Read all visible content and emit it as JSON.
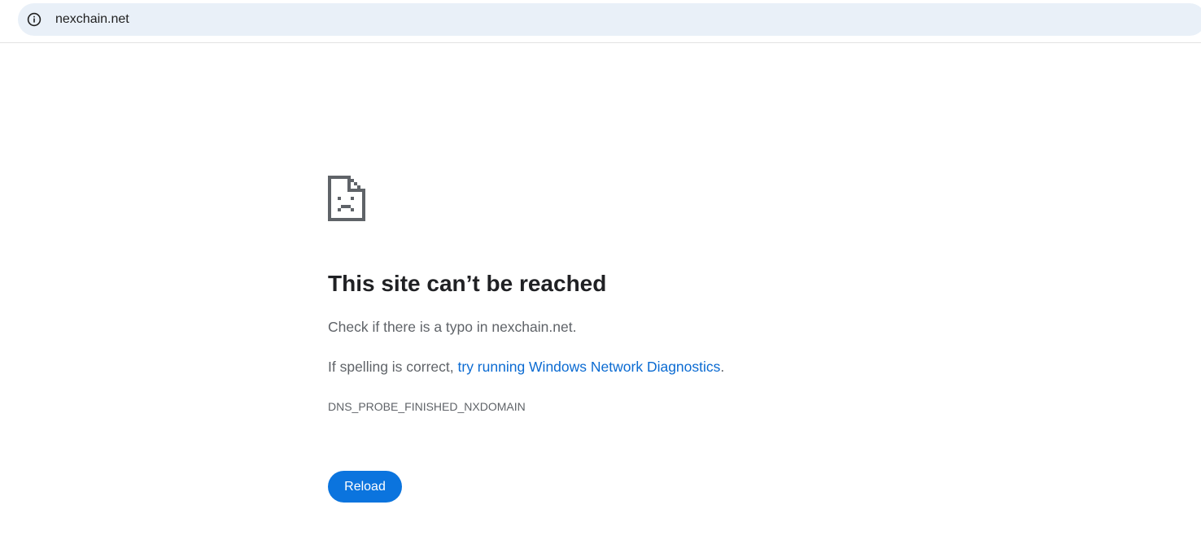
{
  "address_bar": {
    "url": "nexchain.net",
    "site_info_icon": "info-circle-icon"
  },
  "error_page": {
    "icon": "sad-page-icon",
    "title": "This site can’t be reached",
    "line1": "Check if there is a typo in nexchain.net.",
    "line2_prefix": "If spelling is correct, ",
    "line2_link": "try running Windows Network Diagnostics",
    "line2_suffix": ".",
    "error_code": "DNS_PROBE_FINISHED_NXDOMAIN",
    "reload_label": "Reload"
  },
  "colors": {
    "omnibox_bg": "#e9f0f8",
    "link": "#0b6bd2",
    "button": "#0b74de",
    "title": "#202124",
    "body_text": "#5f6368"
  }
}
